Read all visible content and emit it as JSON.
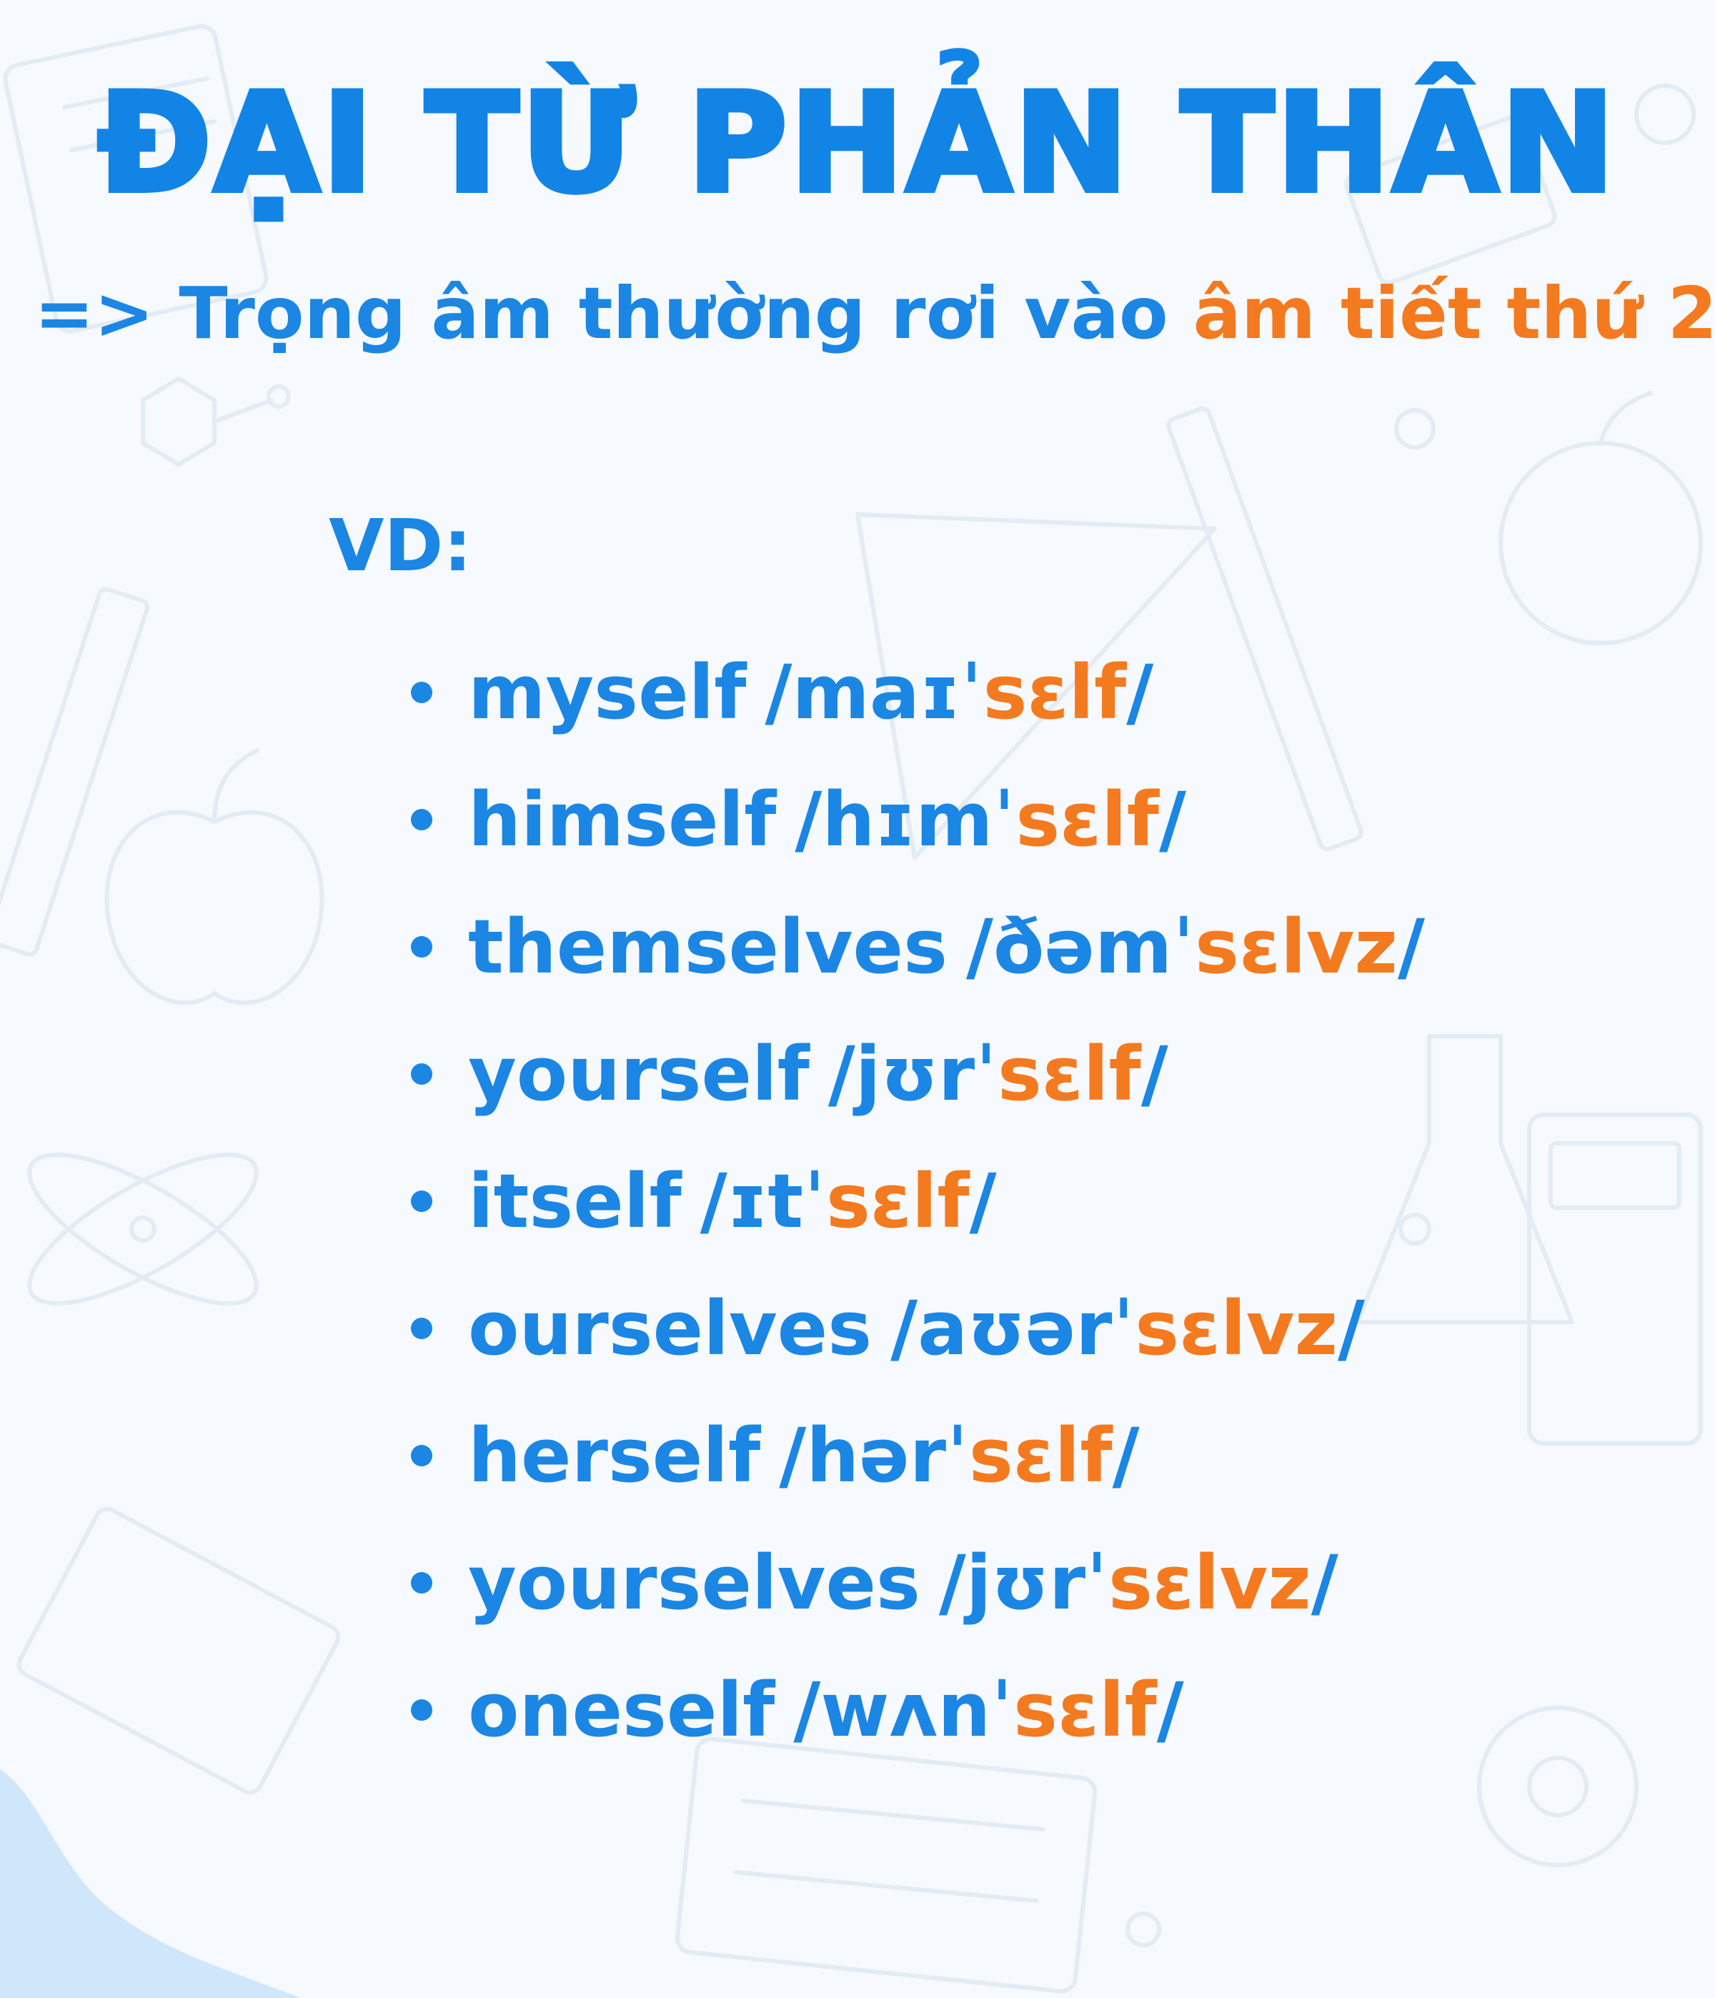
{
  "title": "ĐẠI TỪ PHẢN THÂN",
  "subtitle": {
    "prefix": "=> Trọng âm thường rơi vào ",
    "highlight": "âm tiết thứ 2"
  },
  "example_label": "VD:",
  "examples": [
    {
      "word": "myself",
      "ipa_start": "/maɪˈ",
      "ipa_stress": "sɛlf",
      "ipa_end": "/"
    },
    {
      "word": "himself",
      "ipa_start": "/hɪmˈ",
      "ipa_stress": "sɛlf",
      "ipa_end": "/"
    },
    {
      "word": "themselves",
      "ipa_start": "/ðəmˈ",
      "ipa_stress": "sɛlvz",
      "ipa_end": "/"
    },
    {
      "word": "yourself",
      "ipa_start": "/jʊrˈ",
      "ipa_stress": "sɛlf",
      "ipa_end": "/"
    },
    {
      "word": "itself",
      "ipa_start": "/ɪtˈ",
      "ipa_stress": "sɛlf",
      "ipa_end": "/"
    },
    {
      "word": "ourselves",
      "ipa_start": "/aʊərˈ",
      "ipa_stress": "sɛlvz",
      "ipa_end": "/"
    },
    {
      "word": "herself",
      "ipa_start": "/hərˈ",
      "ipa_stress": "sɛlf",
      "ipa_end": "/"
    },
    {
      "word": "yourselves",
      "ipa_start": "/jʊrˈ",
      "ipa_stress": "sɛlvz",
      "ipa_end": "/"
    },
    {
      "word": "oneself",
      "ipa_start": "/wʌnˈ",
      "ipa_stress": "sɛlf",
      "ipa_end": "/"
    }
  ],
  "colors": {
    "primary": "#1b86e3",
    "accent": "#f47a1f",
    "background": "#f6f9fd"
  }
}
